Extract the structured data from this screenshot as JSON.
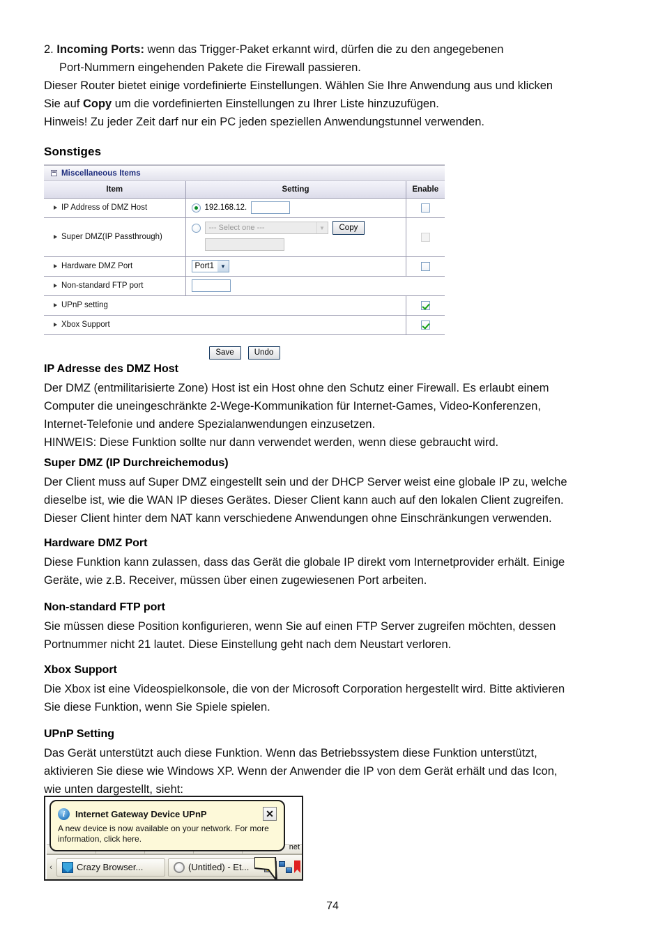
{
  "intro": {
    "line1_num": "2.",
    "line1_bold": "Incoming Ports:",
    "line1_rest": " wenn das Trigger-Paket erkannt wird, dürfen die zu den angegebenen",
    "line2": "Port-Nummern eingehenden Pakete die Firewall passieren.",
    "line3": "Dieser Router bietet einige vordefinierte Einstellungen. Wählen Sie Ihre Anwendung aus und klicken",
    "line4_a": "Sie auf ",
    "line4_bold": "Copy",
    "line4_b": " um die vordefinierten Einstellungen zu Ihrer Liste hinzuzufügen.",
    "line5": "Hinweis! Zu jeder Zeit darf nur ein PC jeden speziellen Anwendungstunnel verwenden."
  },
  "section_heading": "Sonstiges",
  "panel": {
    "title": "Miscellaneous Items",
    "columns": {
      "item": "Item",
      "setting": "Setting",
      "enable": "Enable"
    },
    "rows": {
      "dmz_host": {
        "label": "IP Address of DMZ Host",
        "ip_prefix": "192.168.12.",
        "ip_value": "",
        "radio_selected": true,
        "enabled": false
      },
      "super_dmz": {
        "label": "Super DMZ(IP Passthrough)",
        "select_value": "--- Select one ---",
        "copy_label": "Copy",
        "text_value": "",
        "radio_selected": false,
        "enabled": false
      },
      "hw_dmz_port": {
        "label": "Hardware DMZ Port",
        "select_value": "Port1",
        "enabled": false
      },
      "ftp_port": {
        "label": "Non-standard FTP port",
        "value": ""
      },
      "upnp": {
        "label": "UPnP setting",
        "enabled": true
      },
      "xbox": {
        "label": "Xbox Support",
        "enabled": true
      }
    },
    "buttons": {
      "save": "Save",
      "undo": "Undo"
    }
  },
  "sections": [
    {
      "heading": "IP Adresse des DMZ Host",
      "lines": [
        "Der DMZ (entmilitarisierte Zone) Host ist ein Host ohne den Schutz einer Firewall. Es erlaubt einem",
        "Computer die uneingeschränkte 2-Wege-Kommunikation für Internet-Games, Video-Konferenzen,",
        "Internet-Telefonie und andere Spezialanwendungen einzusetzen.",
        "HINWEIS: Diese Funktion sollte nur dann verwendet werden, wenn diese gebraucht wird."
      ]
    },
    {
      "heading": "Super DMZ (IP Durchreichemodus)",
      "lines": [
        "Der Client muss auf Super DMZ eingestellt sein und der DHCP Server weist eine globale IP zu, welche",
        "dieselbe ist, wie die WAN IP dieses Gerätes. Dieser Client kann auch auf den lokalen Client zugreifen.",
        "Dieser Client hinter dem NAT kann verschiedene Anwendungen ohne Einschränkungen verwenden."
      ]
    },
    {
      "heading": "Hardware DMZ Port",
      "lines": [
        "Diese Funktion kann zulassen, dass das Gerät die globale IP direkt vom Internetprovider erhält. Einige",
        "Geräte, wie z.B. Receiver, müssen über einen zugewiesenen Port arbeiten."
      ]
    },
    {
      "heading": "Non-standard FTP port",
      "lines": [
        "Sie müssen diese Position konfigurieren, wenn Sie auf einen FTP Server zugreifen möchten, dessen",
        "Portnummer nicht 21 lautet. Diese Einstellung geht nach dem Neustart verloren."
      ]
    },
    {
      "heading": "Xbox Support",
      "lines": [
        "Die Xbox ist eine Videospielkonsole, die von der Microsoft Corporation hergestellt wird. Bitte aktivieren",
        "Sie diese Funktion, wenn Sie Spiele spielen."
      ]
    },
    {
      "heading": "UPnP Setting",
      "lines": [
        "Das Gerät unterstützt auch diese Funktion. Wenn das Betriebssystem diese Funktion unterstützt,",
        "aktivieren Sie diese wie Windows XP. Wenn der Anwender die IP von dem Gerät erhält und das Icon,",
        "wie unten dargestellt, sieht:"
      ]
    }
  ],
  "screenshot": {
    "balloon": {
      "title": "Internet Gateway Device UPnP",
      "close_label": "✕",
      "body_line1": "A new device is now available on your network. For more",
      "body_line2": "information, click here."
    },
    "desktop_word": "net",
    "taskbar": {
      "overflow_arrow": "‹",
      "button1": "Crazy Browser...",
      "button2": "(Untitled) - Et..."
    }
  },
  "page_number": "74",
  "colors": {
    "panel_title_text": "#1e2d7d",
    "checkbox_check": "#12a012",
    "radio_dot": "#0a8a27",
    "balloon_bg": "#fdf9d9"
  }
}
